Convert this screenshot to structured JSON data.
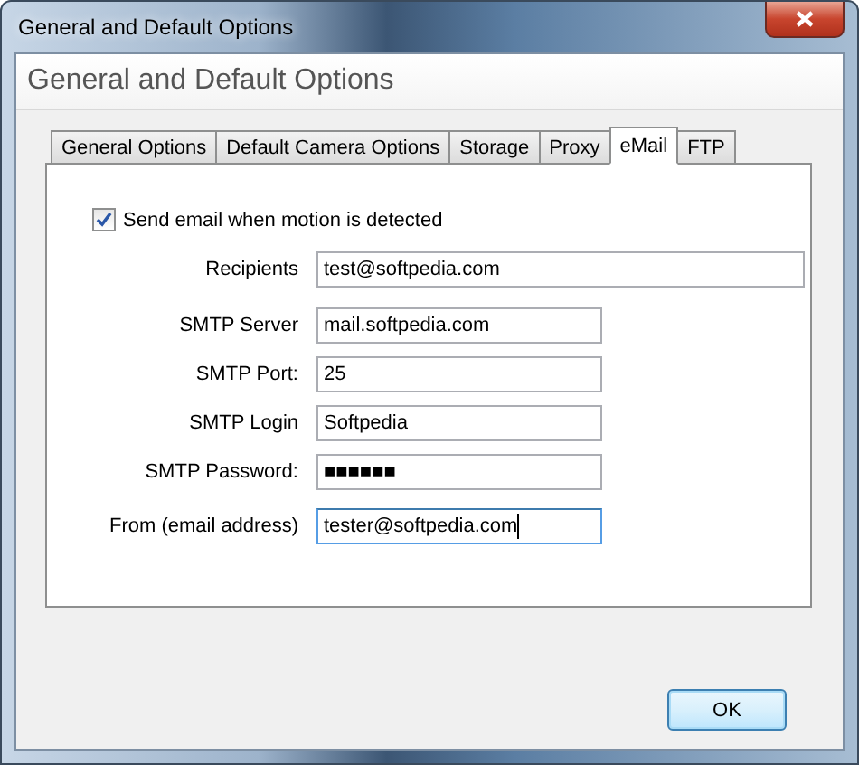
{
  "window": {
    "title": "General and Default Options"
  },
  "header": {
    "title": "General and Default Options"
  },
  "tabs": [
    {
      "label": "General Options",
      "selected": false
    },
    {
      "label": "Default Camera Options",
      "selected": false
    },
    {
      "label": "Storage",
      "selected": false
    },
    {
      "label": "Proxy",
      "selected": false
    },
    {
      "label": "eMail",
      "selected": true
    },
    {
      "label": "FTP",
      "selected": false
    }
  ],
  "send_email": {
    "label": "Send email when motion is detected",
    "checked": true
  },
  "fields": [
    {
      "label": "Recipients",
      "value": "test@softpedia.com",
      "wide": true,
      "focused": false
    },
    {
      "label": "SMTP Server",
      "value": "mail.softpedia.com",
      "wide": false,
      "focused": false
    },
    {
      "label": "SMTP Port:",
      "value": "25",
      "wide": false,
      "focused": false
    },
    {
      "label": "SMTP Login",
      "value": "Softpedia",
      "wide": false,
      "focused": false
    },
    {
      "label": "SMTP Password:",
      "value": "■■■■■■",
      "wide": false,
      "focused": false
    },
    {
      "label": "From (email address)",
      "value": "tester@softpedia.com",
      "wide": false,
      "focused": true
    }
  ],
  "buttons": [
    {
      "label": "OK"
    }
  ]
}
